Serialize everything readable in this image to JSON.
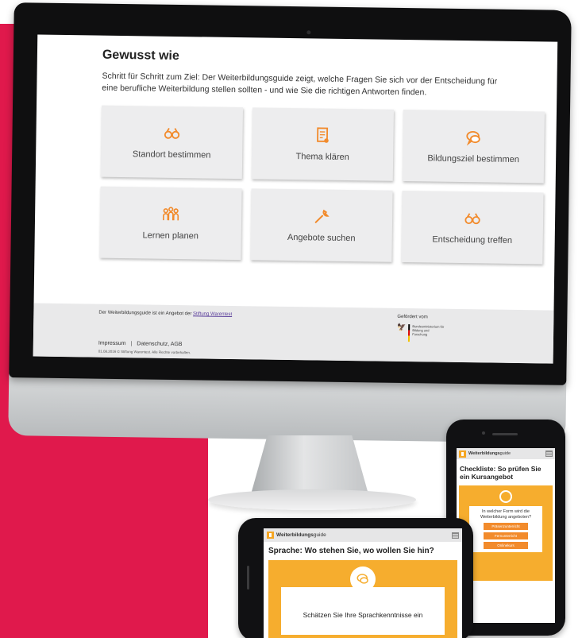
{
  "desktop": {
    "page_title": "Gewusst wie",
    "intro": "Schritt für Schritt zum Ziel: Der Weiterbildungsguide zeigt, welche Fragen Sie sich vor der Entscheidung für eine berufliche Weiterbildung stellen sollten - und wie Sie die richtigen Antworten finden.",
    "cards": [
      {
        "label": "Standort bestimmen",
        "icon": "binoculars-icon"
      },
      {
        "label": "Thema klären",
        "icon": "document-icon"
      },
      {
        "label": "Bildungsziel bestimmen",
        "icon": "chat-bubble-icon"
      },
      {
        "label": "Lernen planen",
        "icon": "people-group-icon"
      },
      {
        "label": "Angebote suchen",
        "icon": "wrench-icon"
      },
      {
        "label": "Entscheidung treffen",
        "icon": "binoculars-icon"
      }
    ],
    "footer": {
      "offer_text": "Der Weiterbildungsguide ist ein Angebot der",
      "offer_link": "Stiftung Warentest",
      "funded_by": "Gefördert vom",
      "ministry": "Bundesministerium für Bildung und Forschung",
      "imprint": "Impressum",
      "separator": "|",
      "privacy": "Datenschutz, AGB",
      "copyright": "01.08.2016 © Stiftung Warentest. Alle Rechte vorbehalten."
    }
  },
  "phone_portrait": {
    "app_name_bold": "Weiterbildungs",
    "app_name_rest": "guide",
    "title": "Checkliste: So prüfen Sie ein Kursangebot",
    "question": "In welcher Form wird die Weiterbildung angeboten?",
    "options": [
      "Präsenzunterricht",
      "Fernunterricht",
      "Onlinekurs"
    ]
  },
  "phone_landscape": {
    "app_name_bold": "Weiterbildungs",
    "app_name_rest": "guide",
    "title": "Sprache: Wo stehen Sie, wo wollen Sie hin?",
    "card_text": "Schätzen Sie Ihre Sprachkenntnisse ein"
  },
  "colors": {
    "accent": "#e0194c",
    "orange": "#f28b2c",
    "panel": "#f6ad2e"
  }
}
